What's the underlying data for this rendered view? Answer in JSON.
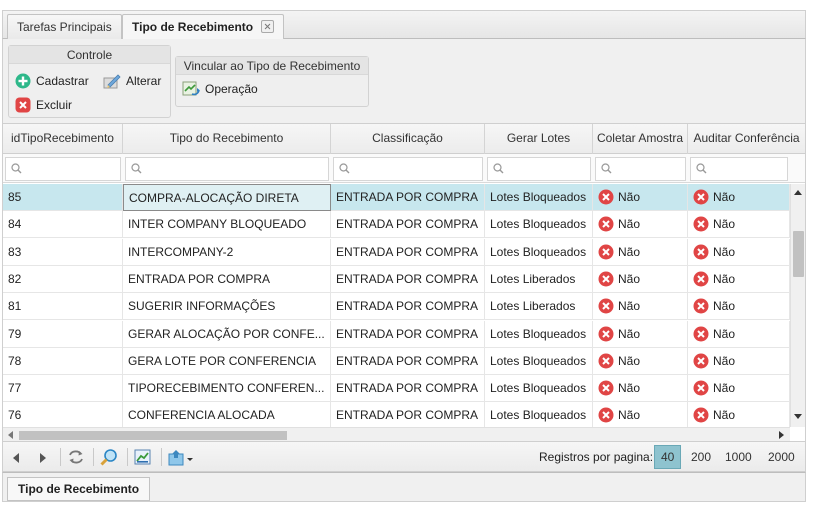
{
  "tabs": [
    {
      "label": "Tarefas Principais"
    },
    {
      "label": "Tipo de Recebimento"
    }
  ],
  "toolbar": {
    "controle": {
      "title": "Controle",
      "cadastrar": "Cadastrar",
      "alterar": "Alterar",
      "excluir": "Excluir"
    },
    "vincular": {
      "title": "Vincular ao Tipo de Recebimento",
      "operacao": "Operação"
    }
  },
  "grid": {
    "columns": [
      "idTipoRecebimento",
      "Tipo do Recebimento",
      "Classificação",
      "Gerar Lotes",
      "Coletar Amostra",
      "Auditar Conferência"
    ],
    "filter_placeholder": "",
    "rows": [
      {
        "id": "85",
        "tipo": "COMPRA-ALOCAÇÃO DIRETA",
        "classificacao": "ENTRADA POR COMPRA",
        "lotes": "Lotes Bloqueados",
        "amostra": "Não",
        "auditar": "Não"
      },
      {
        "id": "84",
        "tipo": "INTER COMPANY BLOQUEADO",
        "classificacao": "ENTRADA POR COMPRA",
        "lotes": "Lotes Bloqueados",
        "amostra": "Não",
        "auditar": "Não"
      },
      {
        "id": "83",
        "tipo": "INTERCOMPANY-2",
        "classificacao": "ENTRADA POR COMPRA",
        "lotes": "Lotes Bloqueados",
        "amostra": "Não",
        "auditar": "Não"
      },
      {
        "id": "82",
        "tipo": "ENTRADA POR COMPRA",
        "classificacao": "ENTRADA POR COMPRA",
        "lotes": "Lotes Liberados",
        "amostra": "Não",
        "auditar": "Não"
      },
      {
        "id": "81",
        "tipo": "SUGERIR INFORMAÇÕES",
        "classificacao": "ENTRADA POR COMPRA",
        "lotes": "Lotes Liberados",
        "amostra": "Não",
        "auditar": "Não"
      },
      {
        "id": "79",
        "tipo": "GERAR ALOCAÇÃO POR CONFE...",
        "classificacao": "ENTRADA POR COMPRA",
        "lotes": "Lotes Bloqueados",
        "amostra": "Não",
        "auditar": "Não"
      },
      {
        "id": "78",
        "tipo": "GERA LOTE POR CONFERENCIA",
        "classificacao": "ENTRADA POR COMPRA",
        "lotes": "Lotes Bloqueados",
        "amostra": "Não",
        "auditar": "Não"
      },
      {
        "id": "77",
        "tipo": "TIPORECEBIMENTO CONFEREN...",
        "classificacao": "ENTRADA POR COMPRA",
        "lotes": "Lotes Bloqueados",
        "amostra": "Não",
        "auditar": "Não"
      },
      {
        "id": "76",
        "tipo": "CONFERENCIA ALOCADA",
        "classificacao": "ENTRADA POR COMPRA",
        "lotes": "Lotes Bloqueados",
        "amostra": "Não",
        "auditar": "Não"
      }
    ]
  },
  "pager": {
    "label": "Registros por pagina:",
    "options": [
      "40",
      "200",
      "1000",
      "2000"
    ],
    "selected": "40"
  },
  "bottom_tab": {
    "label": "Tipo de Recebimento"
  },
  "colors": {
    "selected_row": "#c7e7ee",
    "add_green": "#2eb88a",
    "delete_red": "#e04545",
    "page_active": "#8ec3cf"
  }
}
